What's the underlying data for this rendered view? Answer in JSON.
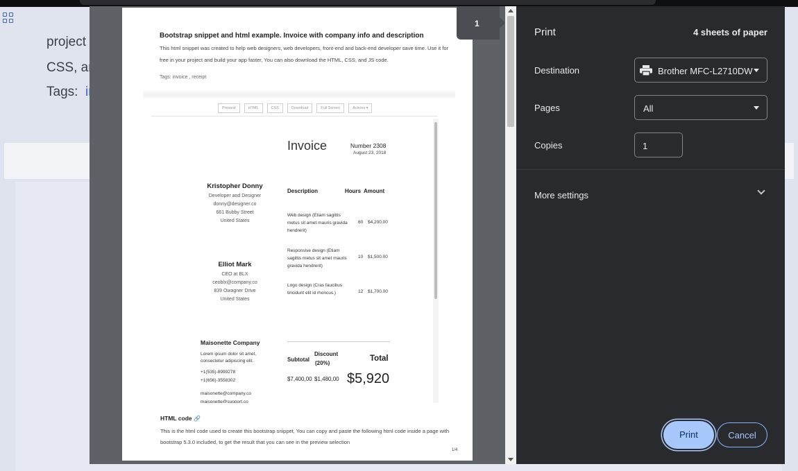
{
  "background_page": {
    "line1": "project",
    "line2": "CSS, an",
    "line3_label": "Tags:",
    "line3_tag": "in"
  },
  "preview": {
    "page_badge": "1",
    "page_number": "1/4",
    "toolbar": [
      "Preview",
      "HTML",
      "CSS",
      "Download",
      "Full Screen",
      "Actions ▾"
    ],
    "snippet_title": "Bootstrap snippet and html example. Invoice with company info and description",
    "snippet_description": "This html snippet was created to help web designers, web developers, front-end and back-end developer save time. Use it for free in your project and build your app faster, You can also download the HTML, CSS, and JS code.",
    "snippet_tags": "Tags:  invoice , receipt",
    "invoice": {
      "title": "Invoice",
      "number": "Number 2308",
      "date": "August 23, 2018",
      "from": {
        "name": "Kristopher Donny",
        "role": "Developer and Designer",
        "email": "donny@designer.co",
        "street": "661 Bubby Street",
        "country": "United States"
      },
      "to": {
        "name": "Elliot Mark",
        "role": "CEO at BLX",
        "email": "ceoblx@company.co",
        "street": "839 Owagner Drive",
        "country": "United States"
      },
      "headers": {
        "description": "Description",
        "hours": "Hours",
        "amount": "Amount"
      },
      "items": [
        {
          "description": "Web design (Etiam sagittis metus sit amet mauris gravida hendrerit)",
          "hours": "60",
          "amount": "$4,200.00"
        },
        {
          "description": "Responsive design (Etiam sagittis metus sit amet mauris gravida hendrerit)",
          "hours": "10",
          "amount": "$1,500.00"
        },
        {
          "description": "Logo design (Cras faucibus tincidunt elit id rhoncus.)",
          "hours": "12",
          "amount": "$1,700.00"
        }
      ],
      "totals": {
        "subtotal_label": "Subtotal",
        "subtotal": "$7,400,00",
        "discount_label": "Discount",
        "discount_pct": "(20%)",
        "discount": "$1,480,00",
        "total_label": "Total",
        "total": "$5,920"
      },
      "company": {
        "name": "Maisonette Company",
        "text1": "Lorem ipsum dolor sit amet,",
        "text2": "consectetur adipiscing elit.",
        "phone1": "+1(535)-8999278",
        "phone2": "+1(656)-3558302",
        "email1": "maisonette@company.co",
        "email2": "maisonette@support.co"
      }
    },
    "html_code_heading": "HTML code",
    "html_code_description": "This is the html code used to create this bootstrap snippet, You can copy and paste the following html code inside a page with bootstrap 5.3.0 included, to get the result that you can see in the preview selection"
  },
  "settings": {
    "title": "Print",
    "sheets": "4 sheets of paper",
    "destination_label": "Destination",
    "destination_value": "Brother MFC-L2710DW",
    "pages_label": "Pages",
    "pages_value": "All",
    "copies_label": "Copies",
    "copies_value": "1",
    "more_settings": "More settings",
    "print_button": "Print",
    "cancel_button": "Cancel",
    "accent_color": "#a8c7fa"
  }
}
